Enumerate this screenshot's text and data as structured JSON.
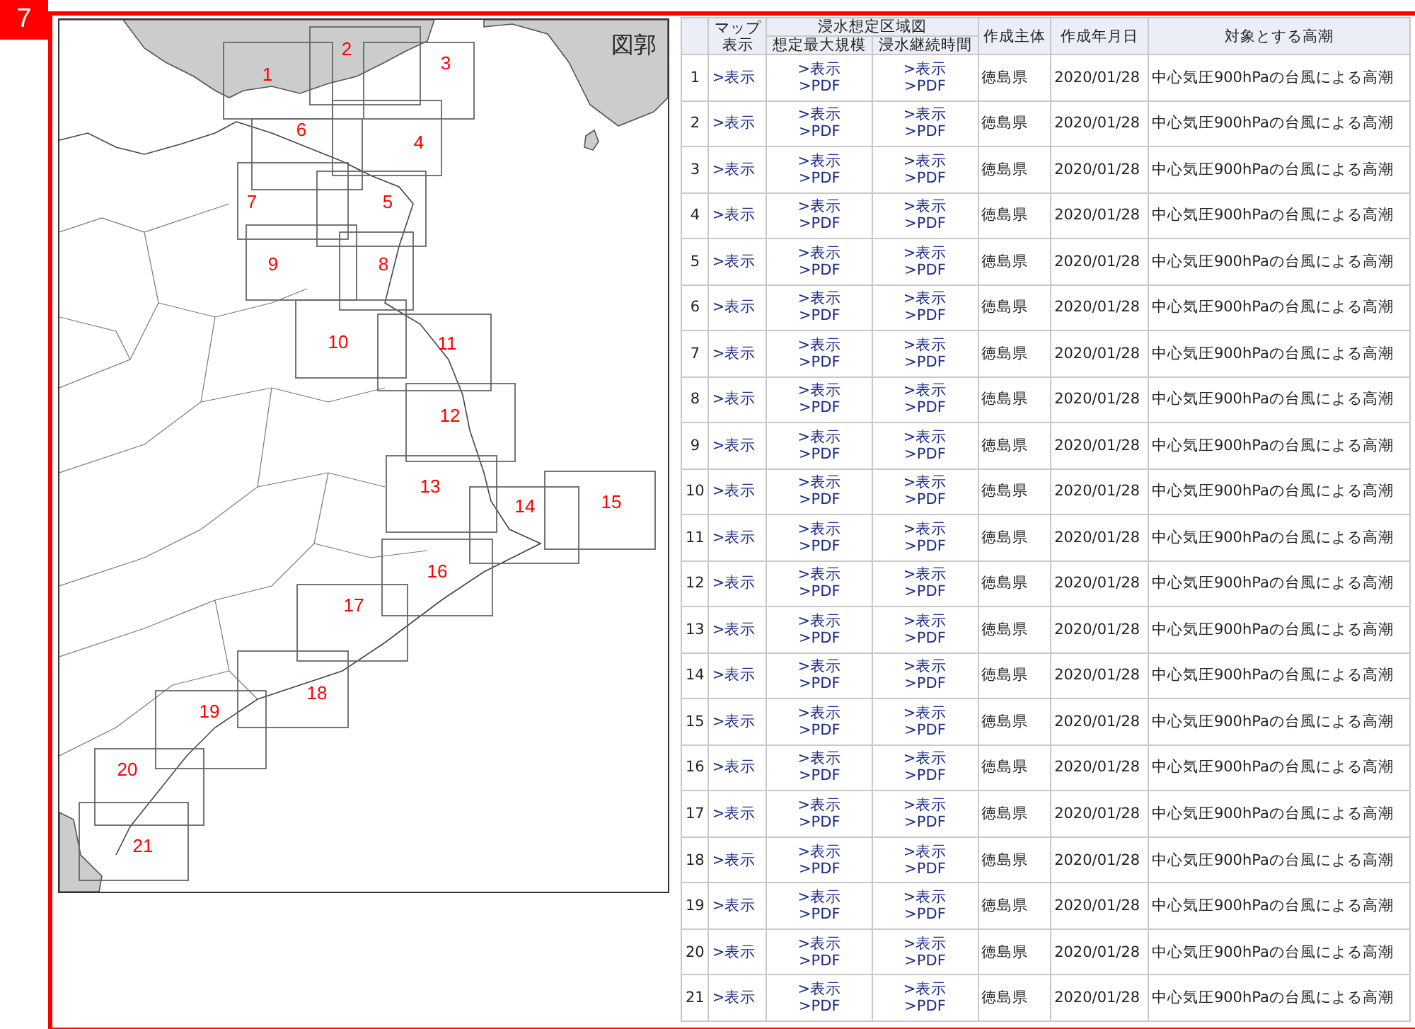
{
  "badge": "7",
  "map": {
    "title": "図郭",
    "tiles": [
      {
        "label": "1"
      },
      {
        "label": "2"
      },
      {
        "label": "3"
      },
      {
        "label": "4"
      },
      {
        "label": "5"
      },
      {
        "label": "6"
      },
      {
        "label": "7"
      },
      {
        "label": "8"
      },
      {
        "label": "9"
      },
      {
        "label": "10"
      },
      {
        "label": "11"
      },
      {
        "label": "12"
      },
      {
        "label": "13"
      },
      {
        "label": "14"
      },
      {
        "label": "15"
      },
      {
        "label": "16"
      },
      {
        "label": "17"
      },
      {
        "label": "18"
      },
      {
        "label": "19"
      },
      {
        "label": "20"
      },
      {
        "label": "21"
      }
    ]
  },
  "table": {
    "columns": {
      "map": "マップ表示",
      "group": "浸水想定区域図",
      "max": "想定最大規模",
      "duration": "浸水継続時間",
      "author": "作成主体",
      "date": "作成年月日",
      "target": "対象とする高潮"
    },
    "rows": [
      {
        "no": "1",
        "map": ">表示",
        "max_view": ">表示",
        "max_pdf": ">PDF",
        "dur_view": ">表示",
        "dur_pdf": ">PDF",
        "author": "徳島県",
        "date": "2020/01/28",
        "target": "中心気圧900hPaの台風による高潮"
      },
      {
        "no": "2",
        "map": ">表示",
        "max_view": ">表示",
        "max_pdf": ">PDF",
        "dur_view": ">表示",
        "dur_pdf": ">PDF",
        "author": "徳島県",
        "date": "2020/01/28",
        "target": "中心気圧900hPaの台風による高潮"
      },
      {
        "no": "3",
        "map": ">表示",
        "max_view": ">表示",
        "max_pdf": ">PDF",
        "dur_view": ">表示",
        "dur_pdf": ">PDF",
        "author": "徳島県",
        "date": "2020/01/28",
        "target": "中心気圧900hPaの台風による高潮"
      },
      {
        "no": "4",
        "map": ">表示",
        "max_view": ">表示",
        "max_pdf": ">PDF",
        "dur_view": ">表示",
        "dur_pdf": ">PDF",
        "author": "徳島県",
        "date": "2020/01/28",
        "target": "中心気圧900hPaの台風による高潮"
      },
      {
        "no": "5",
        "map": ">表示",
        "max_view": ">表示",
        "max_pdf": ">PDF",
        "dur_view": ">表示",
        "dur_pdf": ">PDF",
        "author": "徳島県",
        "date": "2020/01/28",
        "target": "中心気圧900hPaの台風による高潮"
      },
      {
        "no": "6",
        "map": ">表示",
        "max_view": ">表示",
        "max_pdf": ">PDF",
        "dur_view": ">表示",
        "dur_pdf": ">PDF",
        "author": "徳島県",
        "date": "2020/01/28",
        "target": "中心気圧900hPaの台風による高潮"
      },
      {
        "no": "7",
        "map": ">表示",
        "max_view": ">表示",
        "max_pdf": ">PDF",
        "dur_view": ">表示",
        "dur_pdf": ">PDF",
        "author": "徳島県",
        "date": "2020/01/28",
        "target": "中心気圧900hPaの台風による高潮"
      },
      {
        "no": "8",
        "map": ">表示",
        "max_view": ">表示",
        "max_pdf": ">PDF",
        "dur_view": ">表示",
        "dur_pdf": ">PDF",
        "author": "徳島県",
        "date": "2020/01/28",
        "target": "中心気圧900hPaの台風による高潮"
      },
      {
        "no": "9",
        "map": ">表示",
        "max_view": ">表示",
        "max_pdf": ">PDF",
        "dur_view": ">表示",
        "dur_pdf": ">PDF",
        "author": "徳島県",
        "date": "2020/01/28",
        "target": "中心気圧900hPaの台風による高潮"
      },
      {
        "no": "10",
        "map": ">表示",
        "max_view": ">表示",
        "max_pdf": ">PDF",
        "dur_view": ">表示",
        "dur_pdf": ">PDF",
        "author": "徳島県",
        "date": "2020/01/28",
        "target": "中心気圧900hPaの台風による高潮"
      },
      {
        "no": "11",
        "map": ">表示",
        "max_view": ">表示",
        "max_pdf": ">PDF",
        "dur_view": ">表示",
        "dur_pdf": ">PDF",
        "author": "徳島県",
        "date": "2020/01/28",
        "target": "中心気圧900hPaの台風による高潮"
      },
      {
        "no": "12",
        "map": ">表示",
        "max_view": ">表示",
        "max_pdf": ">PDF",
        "dur_view": ">表示",
        "dur_pdf": ">PDF",
        "author": "徳島県",
        "date": "2020/01/28",
        "target": "中心気圧900hPaの台風による高潮"
      },
      {
        "no": "13",
        "map": ">表示",
        "max_view": ">表示",
        "max_pdf": ">PDF",
        "dur_view": ">表示",
        "dur_pdf": ">PDF",
        "author": "徳島県",
        "date": "2020/01/28",
        "target": "中心気圧900hPaの台風による高潮"
      },
      {
        "no": "14",
        "map": ">表示",
        "max_view": ">表示",
        "max_pdf": ">PDF",
        "dur_view": ">表示",
        "dur_pdf": ">PDF",
        "author": "徳島県",
        "date": "2020/01/28",
        "target": "中心気圧900hPaの台風による高潮"
      },
      {
        "no": "15",
        "map": ">表示",
        "max_view": ">表示",
        "max_pdf": ">PDF",
        "dur_view": ">表示",
        "dur_pdf": ">PDF",
        "author": "徳島県",
        "date": "2020/01/28",
        "target": "中心気圧900hPaの台風による高潮"
      },
      {
        "no": "16",
        "map": ">表示",
        "max_view": ">表示",
        "max_pdf": ">PDF",
        "dur_view": ">表示",
        "dur_pdf": ">PDF",
        "author": "徳島県",
        "date": "2020/01/28",
        "target": "中心気圧900hPaの台風による高潮"
      },
      {
        "no": "17",
        "map": ">表示",
        "max_view": ">表示",
        "max_pdf": ">PDF",
        "dur_view": ">表示",
        "dur_pdf": ">PDF",
        "author": "徳島県",
        "date": "2020/01/28",
        "target": "中心気圧900hPaの台風による高潮"
      },
      {
        "no": "18",
        "map": ">表示",
        "max_view": ">表示",
        "max_pdf": ">PDF",
        "dur_view": ">表示",
        "dur_pdf": ">PDF",
        "author": "徳島県",
        "date": "2020/01/28",
        "target": "中心気圧900hPaの台風による高潮"
      },
      {
        "no": "19",
        "map": ">表示",
        "max_view": ">表示",
        "max_pdf": ">PDF",
        "dur_view": ">表示",
        "dur_pdf": ">PDF",
        "author": "徳島県",
        "date": "2020/01/28",
        "target": "中心気圧900hPaの台風による高潮"
      },
      {
        "no": "20",
        "map": ">表示",
        "max_view": ">表示",
        "max_pdf": ">PDF",
        "dur_view": ">表示",
        "dur_pdf": ">PDF",
        "author": "徳島県",
        "date": "2020/01/28",
        "target": "中心気圧900hPaの台風による高潮"
      },
      {
        "no": "21",
        "map": ">表示",
        "max_view": ">表示",
        "max_pdf": ">PDF",
        "dur_view": ">表示",
        "dur_pdf": ">PDF",
        "author": "徳島県",
        "date": "2020/01/28",
        "target": "中心気圧900hPaの台風による高潮"
      }
    ]
  }
}
